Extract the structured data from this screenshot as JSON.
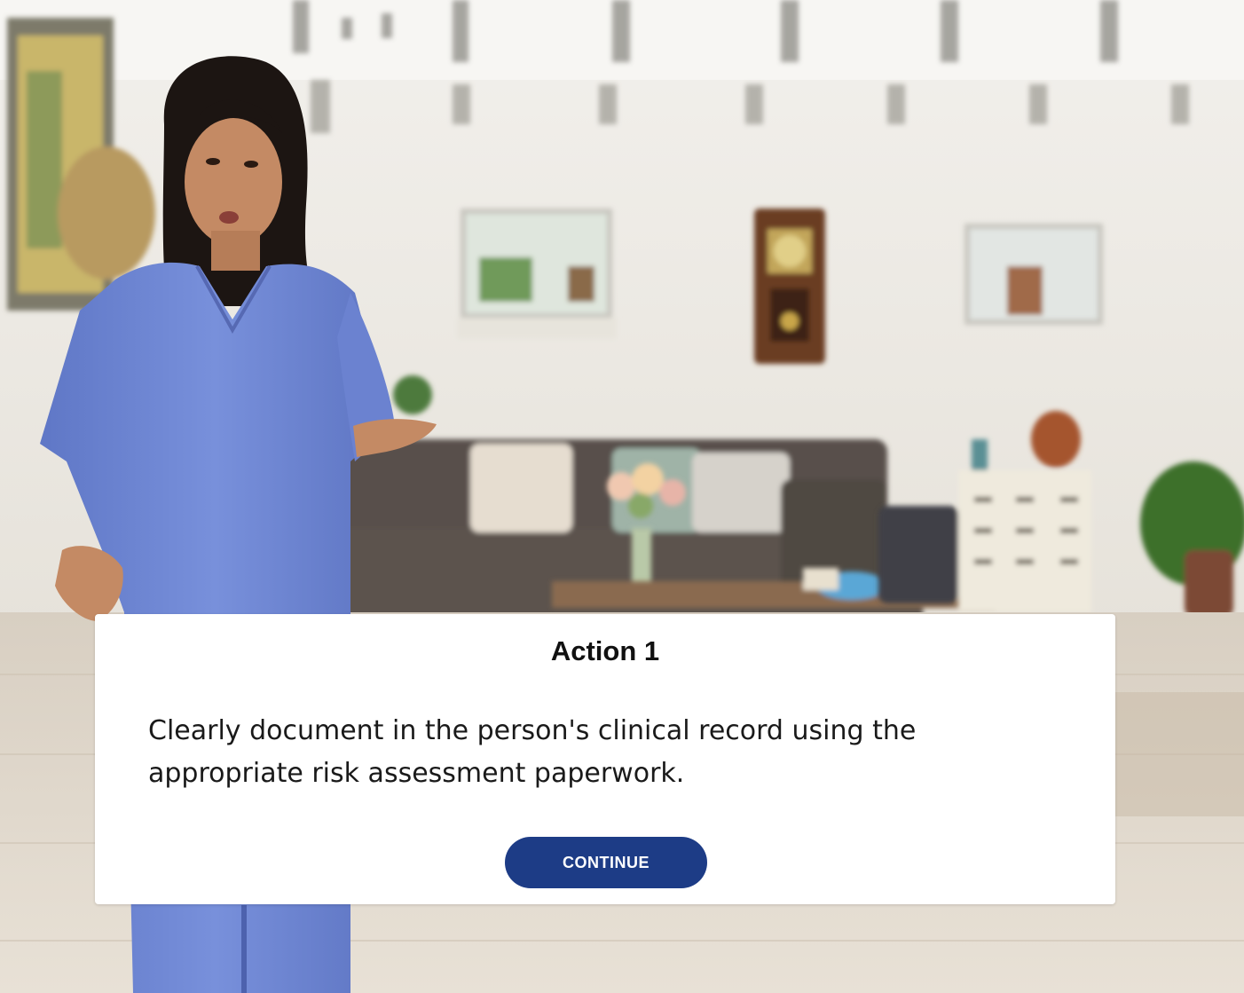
{
  "dialog": {
    "title": "Action 1",
    "body": "Clearly document in the person's clinical record using the appropriate risk assessment paperwork.",
    "continue_label": "CONTINUE"
  },
  "colors": {
    "button_background": "#1d3c86",
    "button_text": "#ffffff",
    "scrubs": "#6f87d3",
    "wall": "#ece8e1"
  }
}
